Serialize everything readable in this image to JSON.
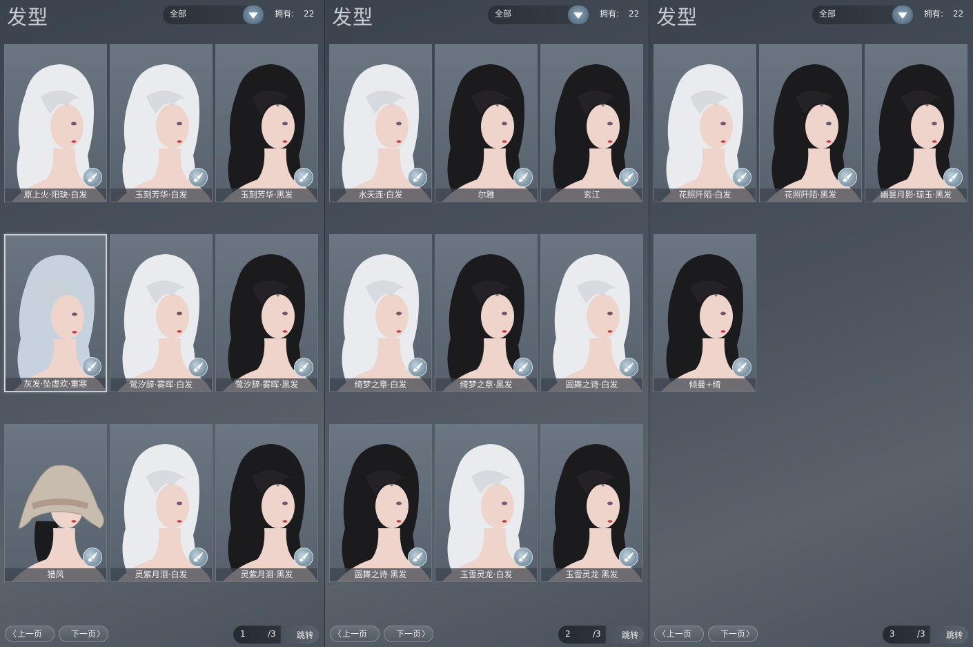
{
  "colors": {
    "white_hair": "#e9ebee",
    "black_hair": "#1b1a1d",
    "silver_hair": "#c7d2de",
    "skin": "#efd4cc",
    "card_bg": "#5e6a76"
  },
  "panels": [
    {
      "title": "发型",
      "filter": "全部",
      "owned_label": "拥有:",
      "owned_count": "22",
      "items": [
        {
          "label": "原上火·阳玦·白发",
          "hair": "white",
          "selected": false
        },
        {
          "label": "玉刻芳华·白发",
          "hair": "white",
          "selected": false
        },
        {
          "label": "玉刻芳华·黑发",
          "hair": "black",
          "selected": false
        },
        {
          "label": "灰发·坠虚欢·重寒",
          "hair": "silver",
          "selected": true
        },
        {
          "label": "鹭汐辞·雾晖·白发",
          "hair": "white",
          "selected": false
        },
        {
          "label": "鹭汐辞·雾晖·黑发",
          "hair": "black",
          "selected": false
        },
        {
          "label": "猎风",
          "hair": "hat",
          "selected": false
        },
        {
          "label": "灵紫月泪·白发",
          "hair": "white",
          "selected": false
        },
        {
          "label": "灵紫月泪·黑发",
          "hair": "black",
          "selected": false
        }
      ],
      "pager": {
        "prev": "上一页",
        "next": "下一页",
        "current": "1",
        "total": "/3",
        "jump": "跳转"
      }
    },
    {
      "title": "发型",
      "filter": "全部",
      "owned_label": "拥有:",
      "owned_count": "22",
      "items": [
        {
          "label": "水天连·白发",
          "hair": "white",
          "selected": false
        },
        {
          "label": "尔雅",
          "hair": "black",
          "selected": false
        },
        {
          "label": "玄江",
          "hair": "black",
          "selected": false
        },
        {
          "label": "绮梦之章·白发",
          "hair": "white",
          "selected": false
        },
        {
          "label": "绮梦之章·黑发",
          "hair": "black",
          "selected": false
        },
        {
          "label": "圆舞之诗·白发",
          "hair": "white",
          "selected": false
        },
        {
          "label": "圆舞之诗·黑发",
          "hair": "black",
          "selected": false
        },
        {
          "label": "玉雪灵龙·白发",
          "hair": "white",
          "selected": false
        },
        {
          "label": "玉雪灵龙·黑发",
          "hair": "black",
          "selected": false
        }
      ],
      "pager": {
        "prev": "上一页",
        "next": "下一页",
        "current": "2",
        "total": "/3",
        "jump": "跳转"
      }
    },
    {
      "title": "发型",
      "filter": "全部",
      "owned_label": "拥有:",
      "owned_count": "22",
      "items": [
        {
          "label": "花照阡陌·白发",
          "hair": "white",
          "selected": false
        },
        {
          "label": "花照阡陌·黑发",
          "hair": "black",
          "selected": false
        },
        {
          "label": "幽昙月影·琼玉·黑发",
          "hair": "black",
          "selected": false
        },
        {
          "label": "倾曼+绮",
          "hair": "black",
          "selected": false
        }
      ],
      "pager": {
        "prev": "上一页",
        "next": "下一页",
        "current": "3",
        "total": "/3",
        "jump": "跳转"
      }
    }
  ]
}
